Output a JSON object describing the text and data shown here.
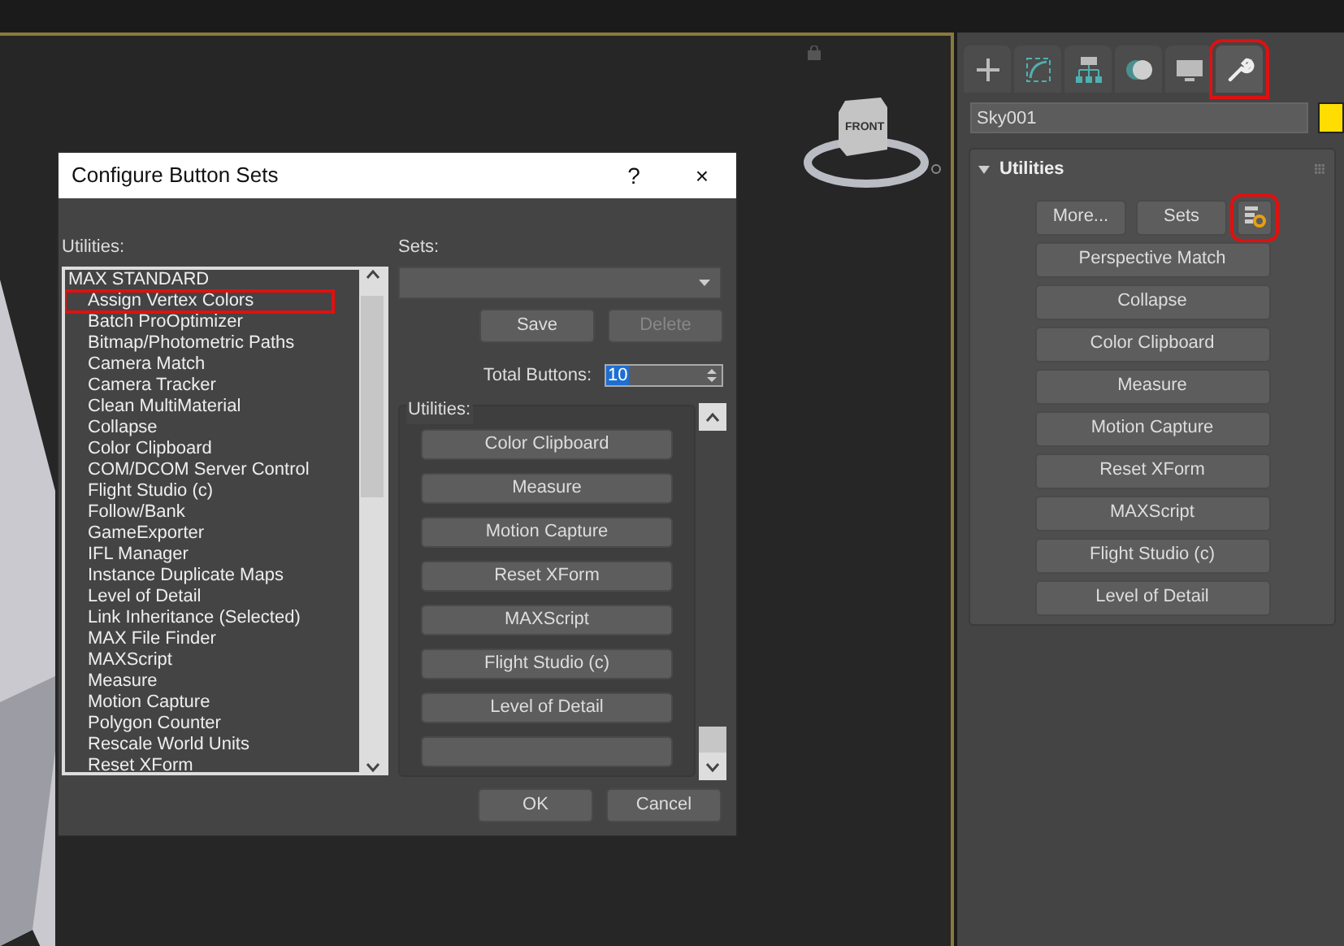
{
  "viewport": {
    "viewcube_label": "FRONT"
  },
  "dialog": {
    "title": "Configure Button Sets",
    "help": "?",
    "close": "×",
    "utilities_label": "Utilities:",
    "utilities_list": [
      {
        "label": "MAX STANDARD",
        "kind": "header",
        "highlighted": false
      },
      {
        "label": "Assign Vertex Colors",
        "kind": "item",
        "highlighted": true
      },
      {
        "label": "Batch ProOptimizer",
        "kind": "item",
        "highlighted": false
      },
      {
        "label": "Bitmap/Photometric Paths",
        "kind": "item",
        "highlighted": false
      },
      {
        "label": "Camera Match",
        "kind": "item",
        "highlighted": false
      },
      {
        "label": "Camera Tracker",
        "kind": "item",
        "highlighted": false
      },
      {
        "label": "Clean MultiMaterial",
        "kind": "item",
        "highlighted": false
      },
      {
        "label": "Collapse",
        "kind": "item",
        "highlighted": false
      },
      {
        "label": "Color Clipboard",
        "kind": "item",
        "highlighted": false
      },
      {
        "label": "COM/DCOM Server Control",
        "kind": "item",
        "highlighted": false
      },
      {
        "label": "Flight Studio (c)",
        "kind": "item",
        "highlighted": false
      },
      {
        "label": "Follow/Bank",
        "kind": "item",
        "highlighted": false
      },
      {
        "label": "GameExporter",
        "kind": "item",
        "highlighted": false
      },
      {
        "label": "IFL Manager",
        "kind": "item",
        "highlighted": false
      },
      {
        "label": "Instance Duplicate Maps",
        "kind": "item",
        "highlighted": false
      },
      {
        "label": "Level of Detail",
        "kind": "item",
        "highlighted": false
      },
      {
        "label": "Link Inheritance (Selected)",
        "kind": "item",
        "highlighted": false
      },
      {
        "label": "MAX File Finder",
        "kind": "item",
        "highlighted": false
      },
      {
        "label": "MAXScript",
        "kind": "item",
        "highlighted": false
      },
      {
        "label": "Measure",
        "kind": "item",
        "highlighted": false
      },
      {
        "label": "Motion Capture",
        "kind": "item",
        "highlighted": false
      },
      {
        "label": "Polygon Counter",
        "kind": "item",
        "highlighted": false
      },
      {
        "label": "Rescale World Units",
        "kind": "item",
        "highlighted": false
      },
      {
        "label": "Reset XForm",
        "kind": "item",
        "highlighted": false
      }
    ],
    "sets_label": "Sets:",
    "set_buttons": [
      {
        "label": "Save",
        "disabled": false
      },
      {
        "label": "Delete",
        "disabled": true
      }
    ],
    "total_buttons": {
      "label": "Total Buttons:",
      "value": "10"
    },
    "group": {
      "label": "Utilities:",
      "buttons": [
        {
          "kind": "button",
          "label": "Color Clipboard"
        },
        {
          "kind": "button",
          "label": "Measure"
        },
        {
          "kind": "button",
          "label": "Motion Capture"
        },
        {
          "kind": "button",
          "label": "Reset XForm"
        },
        {
          "kind": "button",
          "label": "MAXScript"
        },
        {
          "kind": "button",
          "label": "Flight Studio (c)"
        },
        {
          "kind": "button",
          "label": "Level of Detail"
        },
        {
          "kind": "empty"
        }
      ]
    },
    "footer_buttons": [
      "OK",
      "Cancel"
    ]
  },
  "command_panel": {
    "tabs": [
      {
        "kind": "create",
        "selected": false,
        "highlighted": false
      },
      {
        "kind": "modify",
        "selected": false,
        "highlighted": false
      },
      {
        "kind": "hierarchy",
        "selected": false,
        "highlighted": false
      },
      {
        "kind": "motion",
        "selected": false,
        "highlighted": false
      },
      {
        "kind": "display",
        "selected": false,
        "highlighted": false
      },
      {
        "kind": "utilities",
        "selected": true,
        "highlighted": true
      }
    ],
    "object_name": "Sky001",
    "rollout": {
      "title": "Utilities",
      "expanded": true,
      "more": "More...",
      "sets": "Sets",
      "config_highlighted": true,
      "buttons": [
        "Perspective Match",
        "Collapse",
        "Color Clipboard",
        "Measure",
        "Motion Capture",
        "Reset XForm",
        "MAXScript",
        "Flight Studio (c)",
        "Level of Detail"
      ]
    }
  }
}
